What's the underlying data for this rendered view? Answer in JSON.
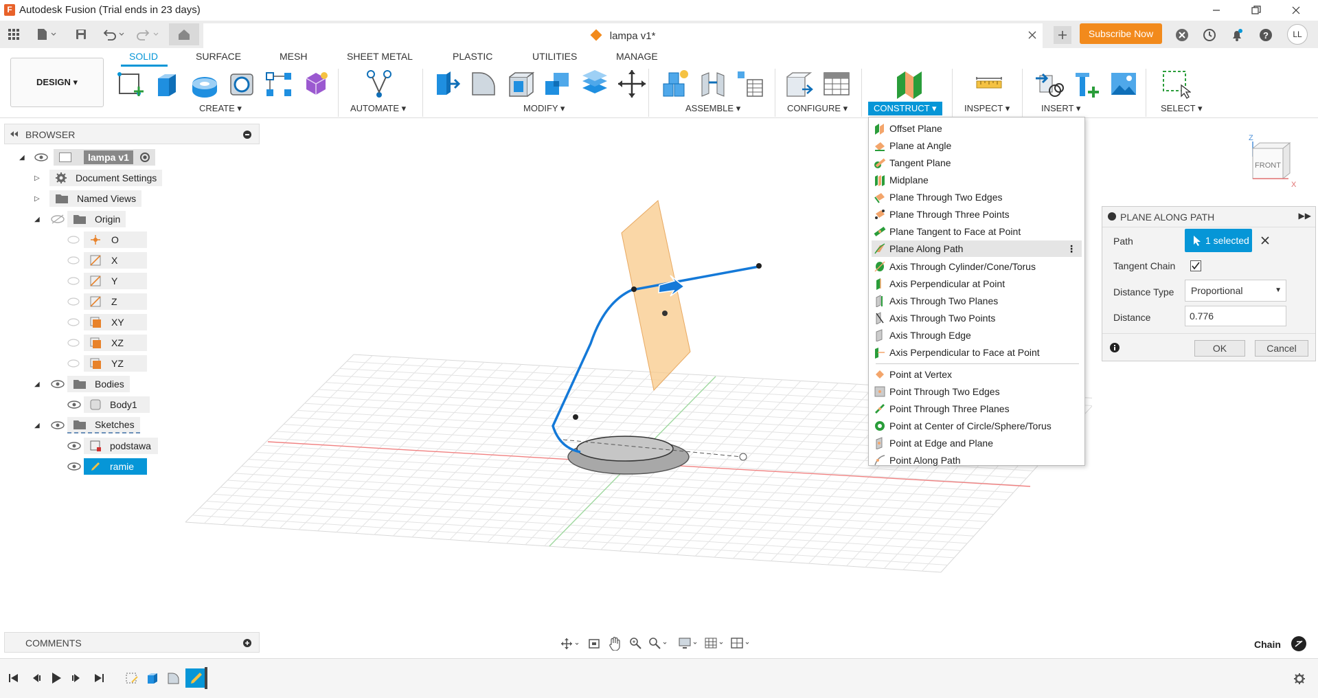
{
  "window": {
    "title": "Autodesk Fusion (Trial ends in 23 days)"
  },
  "document": {
    "tab_title": "lampa v1*"
  },
  "header": {
    "subscribe_label": "Subscribe Now",
    "avatar_initials": "LL"
  },
  "workspace": {
    "label": "DESIGN ▾"
  },
  "ribbon": {
    "tabs": [
      "SOLID",
      "SURFACE",
      "MESH",
      "SHEET METAL",
      "PLASTIC",
      "UTILITIES",
      "MANAGE"
    ],
    "active_tab": "SOLID",
    "groups": [
      "CREATE ▾",
      "AUTOMATE ▾",
      "MODIFY ▾",
      "ASSEMBLE ▾",
      "CONFIGURE ▾",
      "CONSTRUCT ▾",
      "INSPECT ▾",
      "INSERT ▾",
      "SELECT ▾"
    ],
    "active_group": "CONSTRUCT ▾"
  },
  "browser": {
    "title": "BROWSER",
    "root": "lampa v1",
    "items": [
      "Document Settings",
      "Named Views",
      "Origin",
      "O",
      "X",
      "Y",
      "Z",
      "XY",
      "XZ",
      "YZ",
      "Bodies",
      "Body1",
      "Sketches",
      "podstawa",
      "ramie"
    ],
    "selected": "ramie"
  },
  "construct_menu": {
    "items": [
      "Offset Plane",
      "Plane at Angle",
      "Tangent Plane",
      "Midplane",
      "Plane Through Two Edges",
      "Plane Through Three Points",
      "Plane Tangent to Face at Point",
      "Plane Along Path",
      "Axis Through Cylinder/Cone/Torus",
      "Axis Perpendicular at Point",
      "Axis Through Two Planes",
      "Axis Through Two Points",
      "Axis Through Edge",
      "Axis Perpendicular to Face at Point",
      "Point at Vertex",
      "Point Through Two Edges",
      "Point Through Three Planes",
      "Point at Center of Circle/Sphere/Torus",
      "Point at Edge and Plane",
      "Point Along Path"
    ],
    "highlighted": "Plane Along Path"
  },
  "dialog": {
    "title": "PLANE ALONG PATH",
    "path_label": "Path",
    "path_value": "1 selected",
    "tangent_label": "Tangent Chain",
    "tangent_checked": true,
    "distance_type_label": "Distance Type",
    "distance_type_value": "Proportional",
    "distance_label": "Distance",
    "distance_value": "0.776",
    "ok_label": "OK",
    "cancel_label": "Cancel"
  },
  "viewcube": {
    "face_label": "FRONT",
    "z_label": "Z",
    "x_label": "X"
  },
  "comments": {
    "title": "COMMENTS"
  },
  "status": {
    "chain_label": "Chain"
  },
  "colors": {
    "accent": "#0696d7",
    "subscribe": "#f28a1c",
    "plane": "#f8c98a",
    "path": "#1479d8"
  }
}
